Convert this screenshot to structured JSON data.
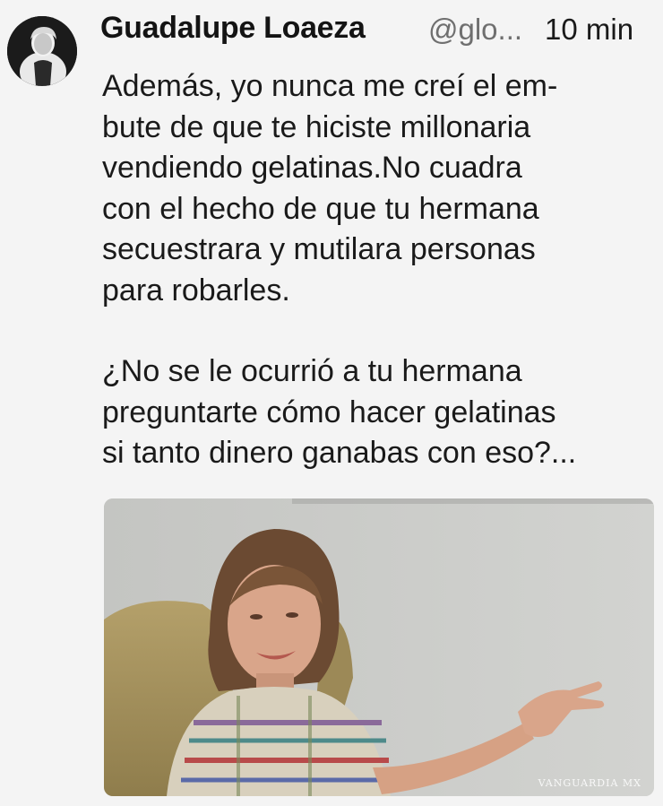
{
  "tweet": {
    "author_name": "Guadalupe Loaeza",
    "author_handle": "@glo...",
    "timestamp": "10 min",
    "paragraphs": [
      "Además, yo nunca me creí el em-\nbute de que te hiciste millonaria\nvendiendo gelatinas.No cuadra\ncon el hecho de que tu hermana\nsecuestrara y mutilara personas\npara robarles.",
      "¿No se le ocurrió a tu hermana\npreguntarte cómo hacer gelatinas\nsi tanto dinero ganabas con eso?..."
    ],
    "media": {
      "watermark": "VANGUARDIA MX"
    }
  }
}
